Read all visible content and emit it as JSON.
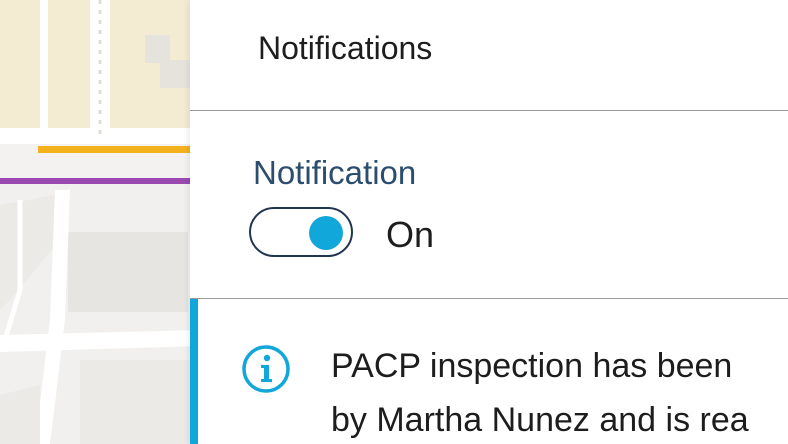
{
  "map": {
    "icon": "map-background"
  },
  "panel": {
    "title": "Notifications"
  },
  "setting": {
    "label": "Notification",
    "toggle_state": "On",
    "toggle_on": true
  },
  "notice": {
    "icon": "info-icon",
    "line1": "PACP inspection has been",
    "line2": "by Martha Nunez and is rea"
  },
  "colors": {
    "accent": "#12a7da",
    "label_blue": "#2b4d6e",
    "toggle_border": "#1f3550",
    "divider": "#9a9a9a"
  }
}
